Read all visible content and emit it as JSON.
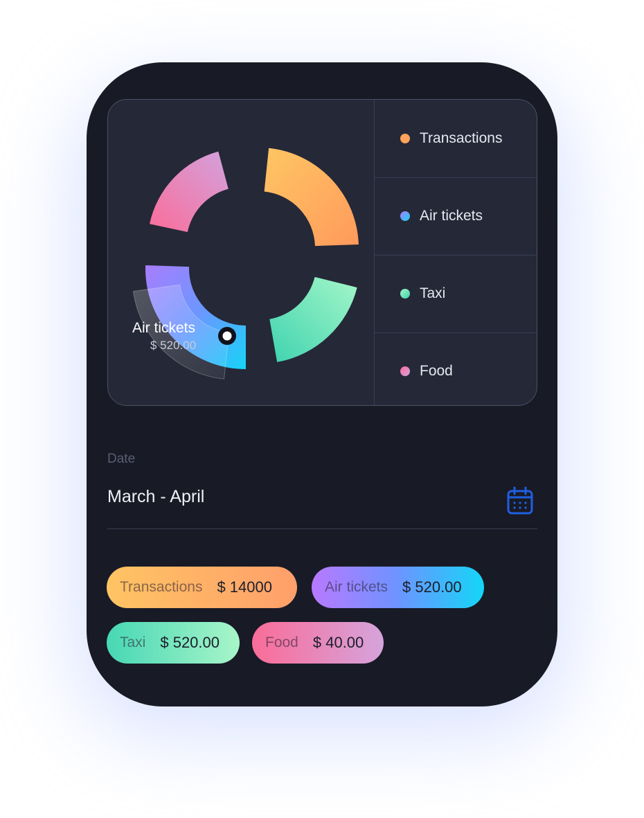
{
  "colors": {
    "transactions": "#ffa45c",
    "air_tickets": "#8e8cff",
    "taxi": "#6ee0b4",
    "food": "#f47fb0",
    "card_bg": "#181a26",
    "panel_bg": "#252837",
    "calendar_accent": "#1f5fe0"
  },
  "chart_data": {
    "type": "pie",
    "categories": [
      "Transactions",
      "Air tickets",
      "Taxi",
      "Food"
    ],
    "tooltip": {
      "label": "Air tickets",
      "value": "$ 520.00"
    }
  },
  "legend": [
    {
      "label": "Transactions",
      "color": "#ffa45c"
    },
    {
      "label": "Air tickets",
      "color": "#8e8cff"
    },
    {
      "label": "Taxi",
      "color": "#6ee0b4"
    },
    {
      "label": "Food",
      "color": "#f47fb0"
    }
  ],
  "date": {
    "label": "Date",
    "value": "March - April",
    "icon": "calendar-icon"
  },
  "pills": [
    {
      "label": "Transactions",
      "value": "$ 14000"
    },
    {
      "label": "Air tickets",
      "value": "$ 520.00"
    },
    {
      "label": "Taxi",
      "value": "$ 520.00"
    },
    {
      "label": "Food",
      "value": "$ 40.00"
    }
  ]
}
